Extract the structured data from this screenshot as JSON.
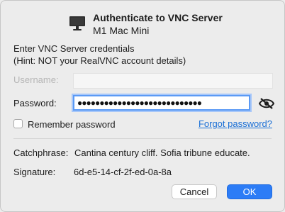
{
  "dialog": {
    "title": "Authenticate to VNC Server",
    "subtitle": "M1 Mac Mini",
    "instructions_line1": "Enter VNC Server credentials",
    "instructions_line2": "(Hint: NOT your RealVNC account details)"
  },
  "form": {
    "username_label": "Username:",
    "username_value": "",
    "password_label": "Password:",
    "password_mask": "●●●●●●●●●●●●●●●●●●●●●●●●●●●●",
    "remember_label": "Remember password",
    "remember_checked": false,
    "forgot_link": "Forgot password?"
  },
  "info": {
    "catchphrase_label": "Catchphrase:",
    "catchphrase_value": "Cantina century cliff. Sofia tribune educate.",
    "signature_label": "Signature:",
    "signature_value": "6d-e5-14-cf-2f-ed-0a-8a"
  },
  "buttons": {
    "cancel": "Cancel",
    "ok": "OK"
  },
  "colors": {
    "accent": "#2c7cf6",
    "link": "#1a6fd6",
    "focus_ring": "#5b9af5"
  },
  "icons": {
    "header": "monitor-icon",
    "password_toggle": "eye-slash-icon"
  }
}
